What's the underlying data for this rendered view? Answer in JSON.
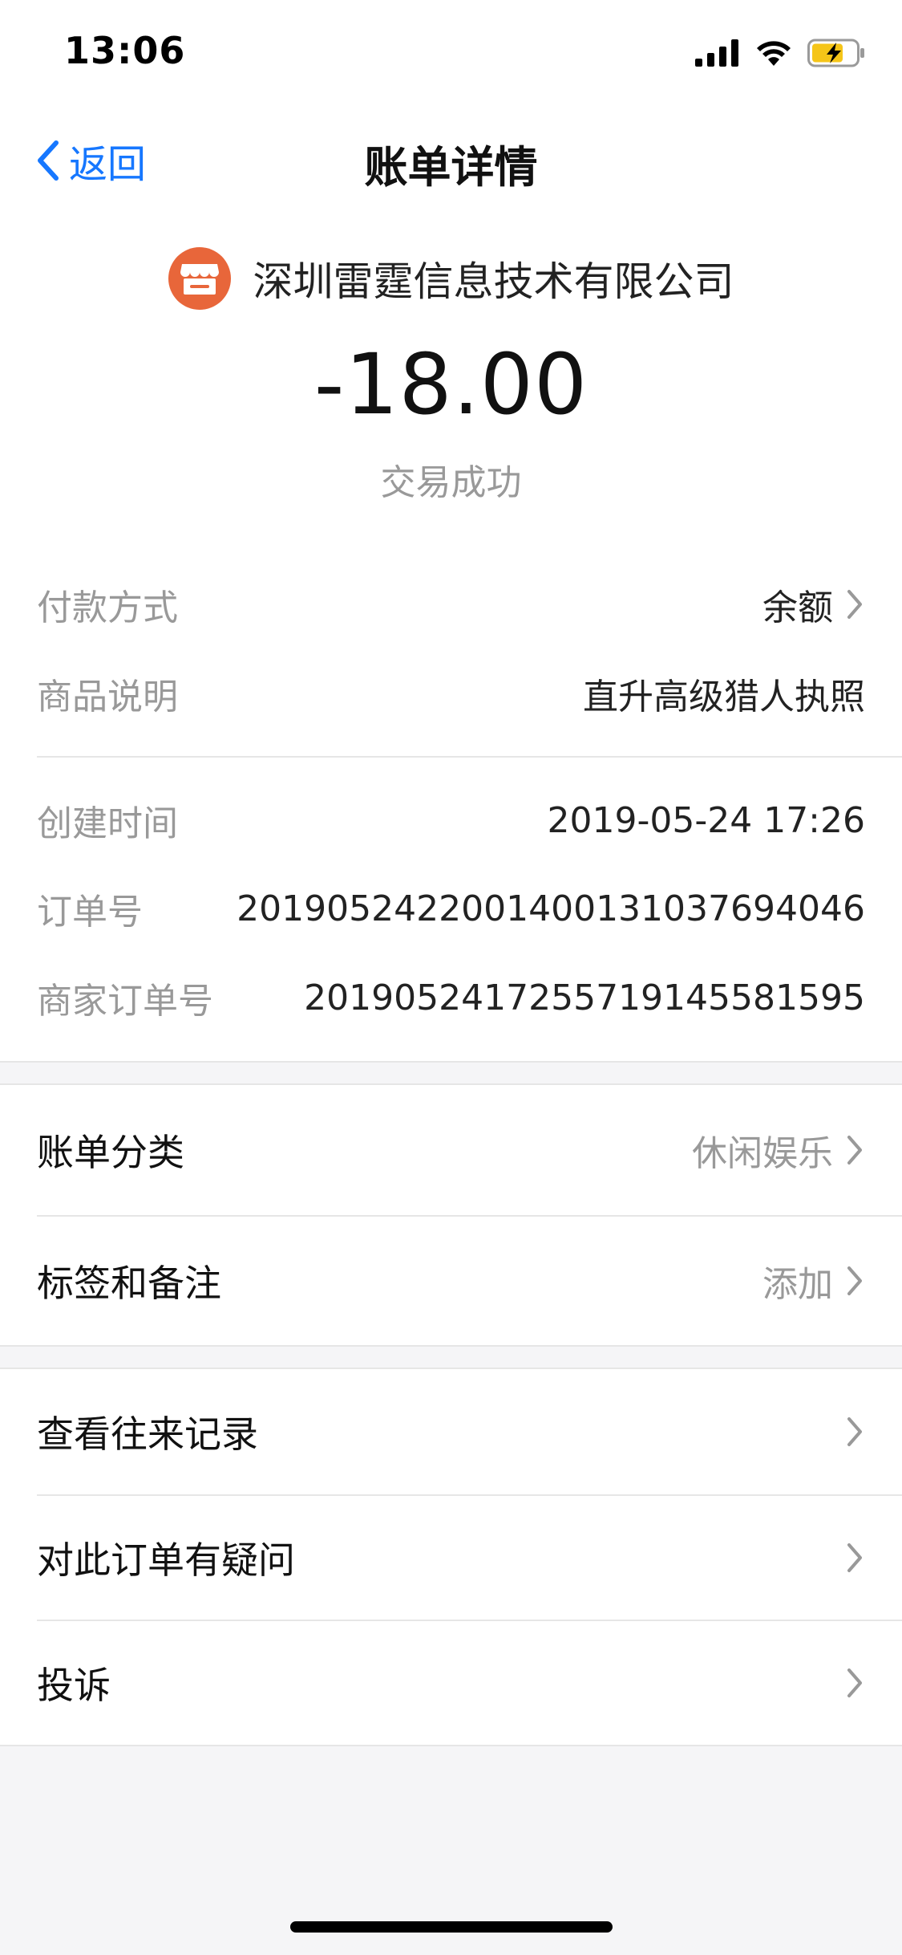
{
  "status_bar": {
    "time": "13:06",
    "icons": [
      "signal-icon",
      "wifi-icon",
      "battery-charging-icon"
    ]
  },
  "nav": {
    "back_label": "返回",
    "title": "账单详情"
  },
  "header": {
    "merchant_icon": "store-icon",
    "merchant_name": "深圳雷霆信息技术有限公司",
    "amount": "-18.00",
    "status": "交易成功"
  },
  "details_group1": [
    {
      "label": "付款方式",
      "value": "余额",
      "has_chevron": true
    },
    {
      "label": "商品说明",
      "value": "直升高级猎人执照",
      "has_chevron": false
    }
  ],
  "details_group2": [
    {
      "label": "创建时间",
      "value": "2019-05-24 17:26"
    },
    {
      "label": "订单号",
      "value": "20190524220014001310376​94046"
    },
    {
      "label": "商家订单号",
      "value": "2019052417255719145581595"
    }
  ],
  "menu_group1": [
    {
      "label": "账单分类",
      "value": "休闲娱乐"
    },
    {
      "label": "标签和备注",
      "value": "添加"
    }
  ],
  "menu_group2": [
    {
      "label": "查看往来记录"
    },
    {
      "label": "对此订单有疑问"
    },
    {
      "label": "投诉"
    }
  ],
  "colors": {
    "accent": "#1677FF",
    "merchant_logo": "#E8663A",
    "background": "#F5F5F7"
  }
}
